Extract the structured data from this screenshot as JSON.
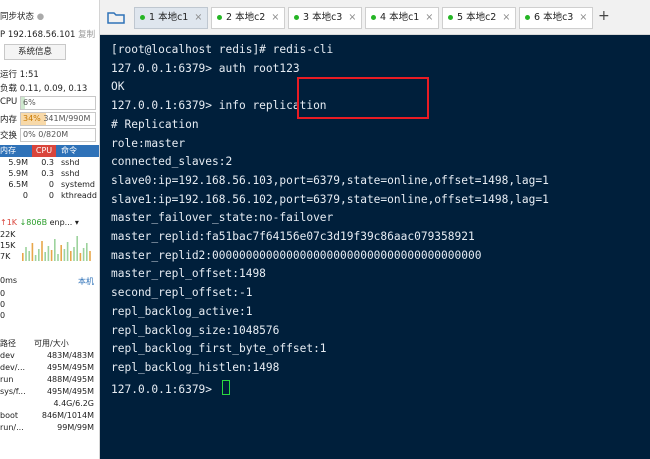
{
  "sidebar": {
    "sync_status": "同步状态",
    "ip_line": "P 192.168.56.101",
    "copy_label": "复制",
    "sysinfo_button": "系统信息",
    "uptime": "运行 1:51",
    "load": "负载 0.11, 0.09, 0.13",
    "cpu": {
      "label": "CPU",
      "value": "6%",
      "percent": 6
    },
    "mem": {
      "label": "内存",
      "value": "34%",
      "detail": "341M/990M",
      "percent": 34
    },
    "swap": {
      "label": "交换",
      "value": "0%",
      "detail": "0/820M",
      "percent": 0
    },
    "proc_headers": [
      "内存",
      "CPU",
      "命令"
    ],
    "processes": [
      {
        "mem": "5.9M",
        "cpu": "0.3",
        "cmd": "sshd"
      },
      {
        "mem": "5.9M",
        "cpu": "0.3",
        "cmd": "sshd"
      },
      {
        "mem": "6.5M",
        "cpu": "0",
        "cmd": "systemd"
      },
      {
        "mem": "0",
        "cpu": "0",
        "cmd": "kthreadd"
      }
    ],
    "net": {
      "up": "↑1K",
      "down": "↓806B",
      "iface": "enp...",
      "scale": [
        "22K",
        "15K",
        "7K"
      ]
    },
    "latency": {
      "label": "0ms",
      "local": "本机",
      "values": [
        "0",
        "0",
        "0"
      ]
    },
    "fs_headers": [
      "路径",
      "可用/大小"
    ],
    "filesystems": [
      {
        "path": "dev",
        "size": "483M/483M"
      },
      {
        "path": "dev/...",
        "size": "495M/495M"
      },
      {
        "path": "run",
        "size": "488M/495M"
      },
      {
        "path": "sys/f...",
        "size": "495M/495M"
      },
      {
        "path": "",
        "size": "4.4G/6.2G"
      },
      {
        "path": "boot",
        "size": "846M/1014M"
      },
      {
        "path": "run/...",
        "size": "99M/99M"
      }
    ]
  },
  "tabs": [
    {
      "label": "1 本地c1",
      "active": true
    },
    {
      "label": "2 本地c2",
      "active": false
    },
    {
      "label": "3 本地c3",
      "active": false
    },
    {
      "label": "4 本地c1",
      "active": false
    },
    {
      "label": "5 本地c2",
      "active": false
    },
    {
      "label": "6 本地c3",
      "active": false
    }
  ],
  "terminal": {
    "lines": [
      "[root@localhost redis]# redis-cli",
      "127.0.0.1:6379> auth root123",
      "OK",
      "127.0.0.1:6379> info replication",
      "# Replication",
      "role:master",
      "connected_slaves:2",
      "slave0:ip=192.168.56.103,port=6379,state=online,offset=1498,lag=1",
      "slave1:ip=192.168.56.102,port=6379,state=online,offset=1498,lag=1",
      "master_failover_state:no-failover",
      "master_replid:fa51bac7f64156e07c3d19f39c86aac079358921",
      "master_replid2:0000000000000000000000000000000000000000",
      "master_repl_offset:1498",
      "second_repl_offset:-1",
      "repl_backlog_active:1",
      "repl_backlog_size:1048576",
      "repl_backlog_first_byte_offset:1",
      "repl_backlog_histlen:1498",
      "127.0.0.1:6379> "
    ]
  },
  "colors": {
    "terminal_bg": "#001f3b",
    "highlight": "#e81c24",
    "accent": "#2f72b8",
    "cursor": "#2bd93f"
  }
}
